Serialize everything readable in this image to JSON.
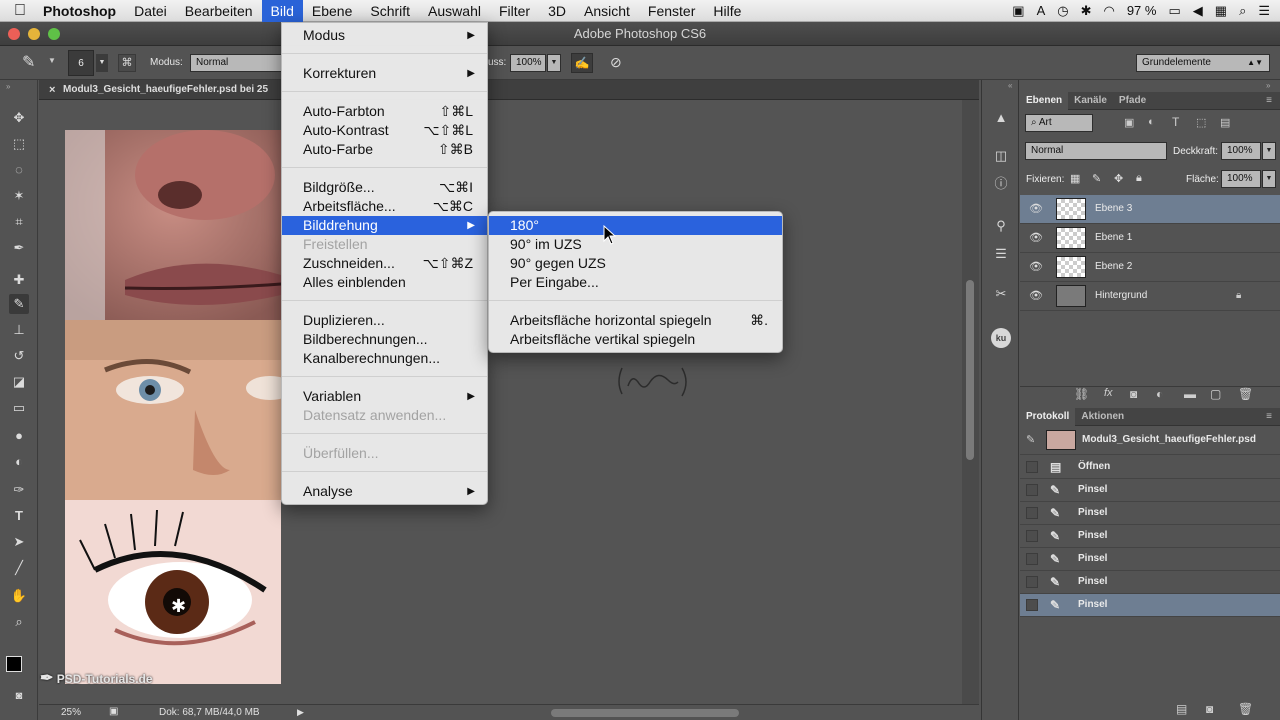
{
  "menubar": {
    "app": "Photoshop",
    "items": [
      "Datei",
      "Bearbeiten",
      "Bild",
      "Ebene",
      "Schrift",
      "Auswahl",
      "Filter",
      "3D",
      "Ansicht",
      "Fenster",
      "Hilfe"
    ],
    "battery": "97 %"
  },
  "window": {
    "title": "Adobe Photoshop CS6"
  },
  "options": {
    "brush_size": "6",
    "mode_label": "Modus:",
    "mode_value": "Normal",
    "flow_label": "uss:",
    "flow_value": "100%",
    "workspace": "Grundelemente"
  },
  "document": {
    "tab_title": "Modul3_Gesicht_haeufigeFehler.psd bei 25",
    "zoom": "25%",
    "doc_size": "Dok: 68,7 MB/44,0 MB",
    "watermark": "PSD-Tutorials.de"
  },
  "bild_menu": {
    "items": [
      {
        "label": "Modus",
        "submenu": true
      },
      {
        "sep": true
      },
      {
        "label": "Korrekturen",
        "submenu": true
      },
      {
        "sep": true
      },
      {
        "label": "Auto-Farbton",
        "shortcut": "⇧⌘L"
      },
      {
        "label": "Auto-Kontrast",
        "shortcut": "⌥⇧⌘L"
      },
      {
        "label": "Auto-Farbe",
        "shortcut": "⇧⌘B"
      },
      {
        "sep": true
      },
      {
        "label": "Bildgröße...",
        "shortcut": "⌥⌘I"
      },
      {
        "label": "Arbeitsfläche...",
        "shortcut": "⌥⌘C"
      },
      {
        "label": "Bilddrehung",
        "submenu": true,
        "highlighted": true
      },
      {
        "label": "Freistellen",
        "disabled": true
      },
      {
        "label": "Zuschneiden...",
        "shortcut": "⌥⇧⌘Z"
      },
      {
        "label": "Alles einblenden"
      },
      {
        "sep": true
      },
      {
        "label": "Duplizieren..."
      },
      {
        "label": "Bildberechnungen..."
      },
      {
        "label": "Kanalberechnungen..."
      },
      {
        "sep": true
      },
      {
        "label": "Variablen",
        "submenu": true
      },
      {
        "label": "Datensatz anwenden...",
        "disabled": true
      },
      {
        "sep": true
      },
      {
        "label": "Überfüllen...",
        "disabled": true
      },
      {
        "sep": true
      },
      {
        "label": "Analyse",
        "submenu": true
      }
    ]
  },
  "rotation_submenu": {
    "items": [
      {
        "label": "180°",
        "highlighted": true
      },
      {
        "label": "90° im UZS"
      },
      {
        "label": "90° gegen UZS"
      },
      {
        "label": "Per Eingabe..."
      },
      {
        "sep": true
      },
      {
        "label": "Arbeitsfläche horizontal spiegeln",
        "shortcut": "⌘."
      },
      {
        "label": "Arbeitsfläche vertikal spiegeln"
      }
    ]
  },
  "layers_panel": {
    "tabs": [
      "Ebenen",
      "Kanäle",
      "Pfade"
    ],
    "filter_kind": "Art",
    "blend_mode": "Normal",
    "opacity_label": "Deckkraft:",
    "opacity_value": "100%",
    "lock_label": "Fixieren:",
    "fill_label": "Fläche:",
    "fill_value": "100%",
    "layers": [
      {
        "name": "Ebene 3",
        "selected": true
      },
      {
        "name": "Ebene 1"
      },
      {
        "name": "Ebene 2"
      },
      {
        "name": "Hintergrund",
        "locked": true
      }
    ]
  },
  "history_panel": {
    "tabs": [
      "Protokoll",
      "Aktionen"
    ],
    "snapshot": "Modul3_Gesicht_haeufigeFehler.psd",
    "steps": [
      "Öffnen",
      "Pinsel",
      "Pinsel",
      "Pinsel",
      "Pinsel",
      "Pinsel",
      "Pinsel"
    ]
  },
  "colors": {
    "menu_highlight": "#2a62dd",
    "panel_bg": "#535353",
    "selected_layer": "#6e7e92"
  }
}
